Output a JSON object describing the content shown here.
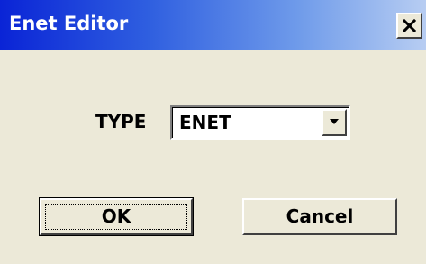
{
  "window": {
    "title": "Enet Editor",
    "close_glyph": "×",
    "colors": {
      "titlebar_start": "#0A24D6",
      "titlebar_end": "#B7CDF2",
      "face": "#ECE9D8"
    }
  },
  "form": {
    "type_label": "TYPE",
    "type_value": "ENET"
  },
  "buttons": {
    "ok_label": "OK",
    "cancel_label": "Cancel"
  },
  "icons": {
    "close": "close-icon",
    "dropdown": "chevron-down-icon"
  }
}
